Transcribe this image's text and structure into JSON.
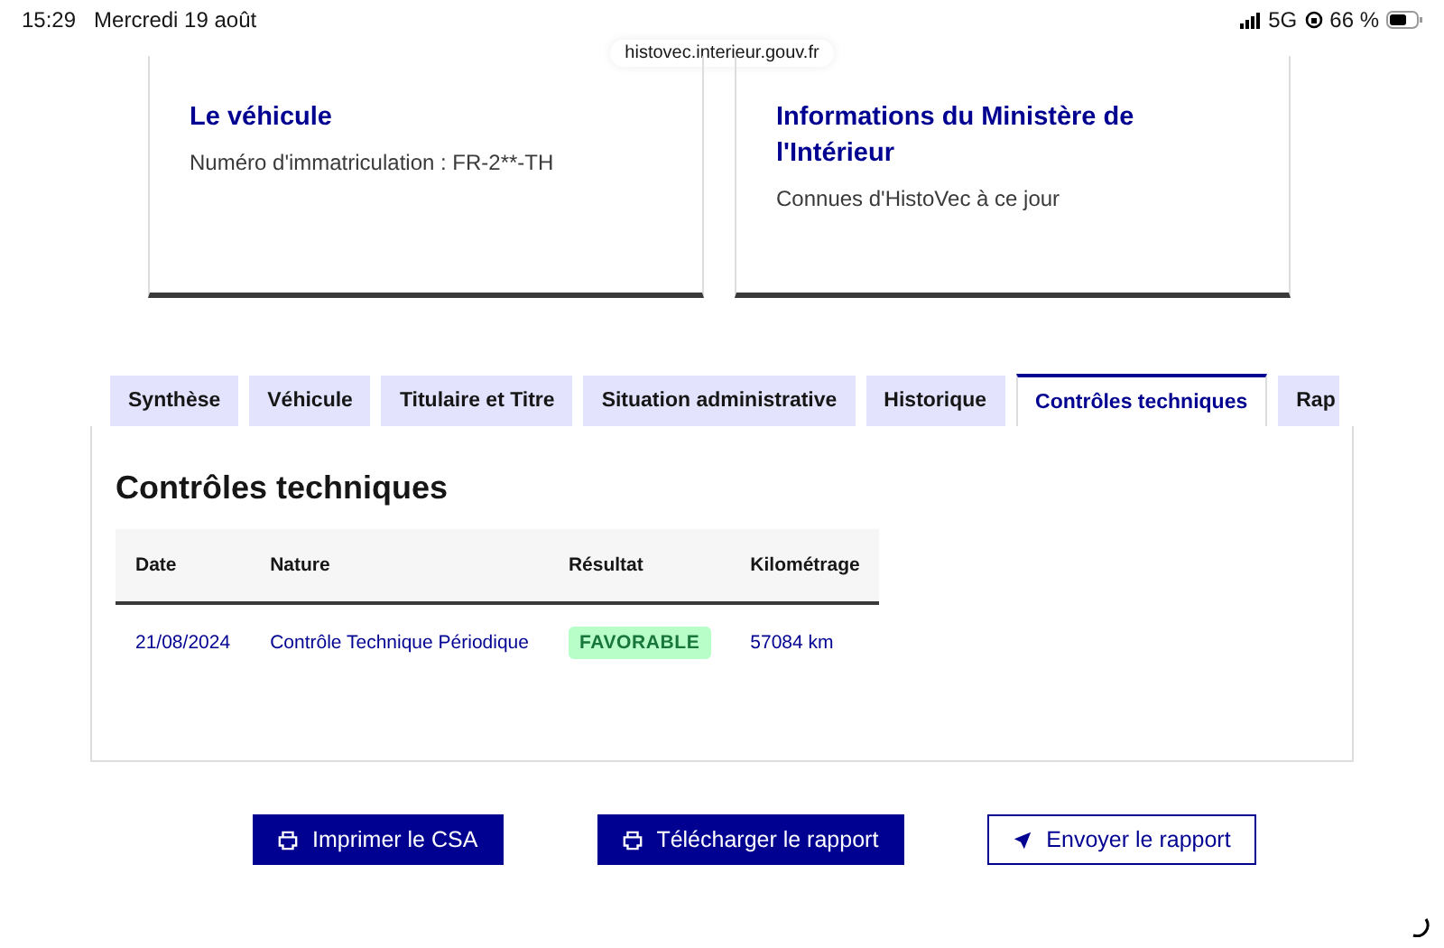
{
  "status_bar": {
    "time": "15:29",
    "date": "Mercredi 19 août",
    "network": "5G",
    "battery": "66 %"
  },
  "address_bar": {
    "url": "histovec.interieur.gouv.fr"
  },
  "cards": [
    {
      "title": "Le véhicule",
      "text": "Numéro d'immatriculation : FR-2**-TH"
    },
    {
      "title": "Informations du Ministère de l'Intérieur",
      "text": "Connues d'HistoVec à ce jour"
    }
  ],
  "tabs": [
    {
      "label": "Synthèse",
      "selected": false
    },
    {
      "label": "Véhicule",
      "selected": false
    },
    {
      "label": "Titulaire et Titre",
      "selected": false
    },
    {
      "label": "Situation administrative",
      "selected": false
    },
    {
      "label": "Historique",
      "selected": false
    },
    {
      "label": "Contrôles techniques",
      "selected": true
    },
    {
      "label": "Rap",
      "selected": false
    }
  ],
  "panel": {
    "title": "Contrôles techniques",
    "table": {
      "columns": [
        "Date",
        "Nature",
        "Résultat",
        "Kilométrage"
      ],
      "rows": [
        {
          "date": "21/08/2024",
          "nature": "Contrôle Technique Périodique",
          "result": "FAVORABLE",
          "mileage": "57084 km"
        }
      ]
    }
  },
  "buttons": [
    {
      "label": "Imprimer le CSA",
      "kind": "print"
    },
    {
      "label": "Télécharger le rapport",
      "kind": "print"
    },
    {
      "label": "Envoyer le rapport",
      "kind": "send"
    }
  ]
}
